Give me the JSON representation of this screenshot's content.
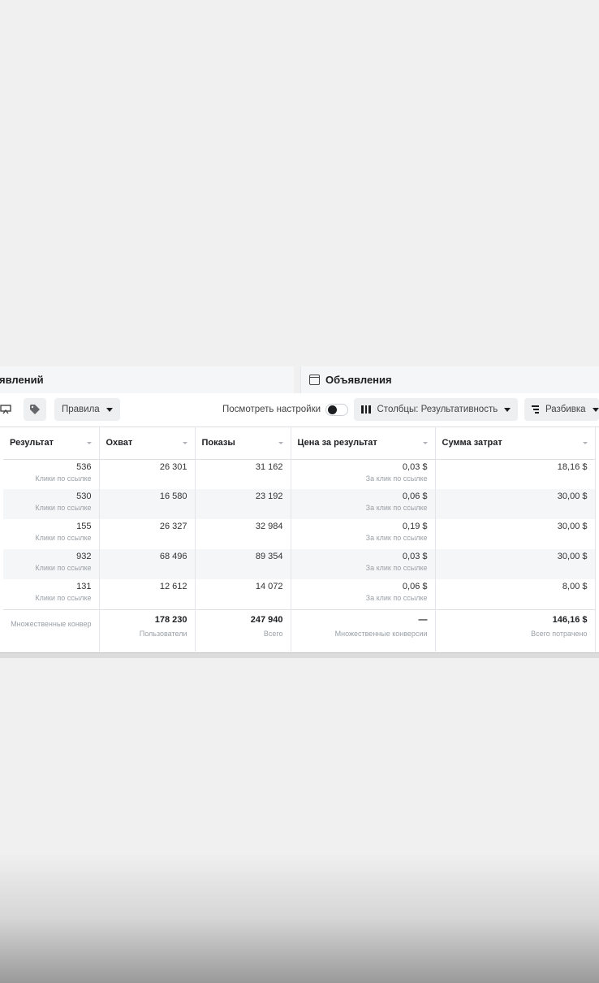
{
  "tabs": {
    "left_label": "явлений",
    "right_label": "Объявления"
  },
  "toolbar": {
    "rules_label": "Правила",
    "view_settings_label": "Посмотреть настройки",
    "columns_label": "Столбцы: Результативность",
    "breakdown_label": "Разбивка"
  },
  "table": {
    "headers": [
      "Результат",
      "Охват",
      "Показы",
      "Цена за результат",
      "Сумма затрат"
    ],
    "rows": [
      {
        "result": "536",
        "result_sub": "Клики по ссылке",
        "reach": "26 301",
        "impressions": "31 162",
        "cpr": "0,03 $",
        "cpr_sub": "За клик по ссылке",
        "spend": "18,16 $"
      },
      {
        "result": "530",
        "result_sub": "Клики по ссылке",
        "reach": "16 580",
        "impressions": "23 192",
        "cpr": "0,06 $",
        "cpr_sub": "За клик по ссылке",
        "spend": "30,00 $"
      },
      {
        "result": "155",
        "result_sub": "Клики по ссылке",
        "reach": "26 327",
        "impressions": "32 984",
        "cpr": "0,19 $",
        "cpr_sub": "За клик по ссылке",
        "spend": "30,00 $"
      },
      {
        "result": "932",
        "result_sub": "Клики по ссылке",
        "reach": "68 496",
        "impressions": "89 354",
        "cpr": "0,03 $",
        "cpr_sub": "За клик по ссылке",
        "spend": "30,00 $"
      },
      {
        "result": "131",
        "result_sub": "Клики по ссылке",
        "reach": "12 612",
        "impressions": "14 072",
        "cpr": "0,06 $",
        "cpr_sub": "За клик по ссылке",
        "spend": "8,00 $"
      }
    ],
    "totals": {
      "result": "",
      "result_sub": "Множественные конвер",
      "reach": "178 230",
      "reach_sub": "Пользователи",
      "impressions": "247 940",
      "impressions_sub": "Всего",
      "cpr": "—",
      "cpr_sub": "Множественные конверсии",
      "spend": "146,16 $",
      "spend_sub": "Всего потрачено"
    }
  },
  "icons": [
    "preview-icon",
    "tag-icon",
    "calendar-icon",
    "columns-icon",
    "breakdown-icon"
  ]
}
